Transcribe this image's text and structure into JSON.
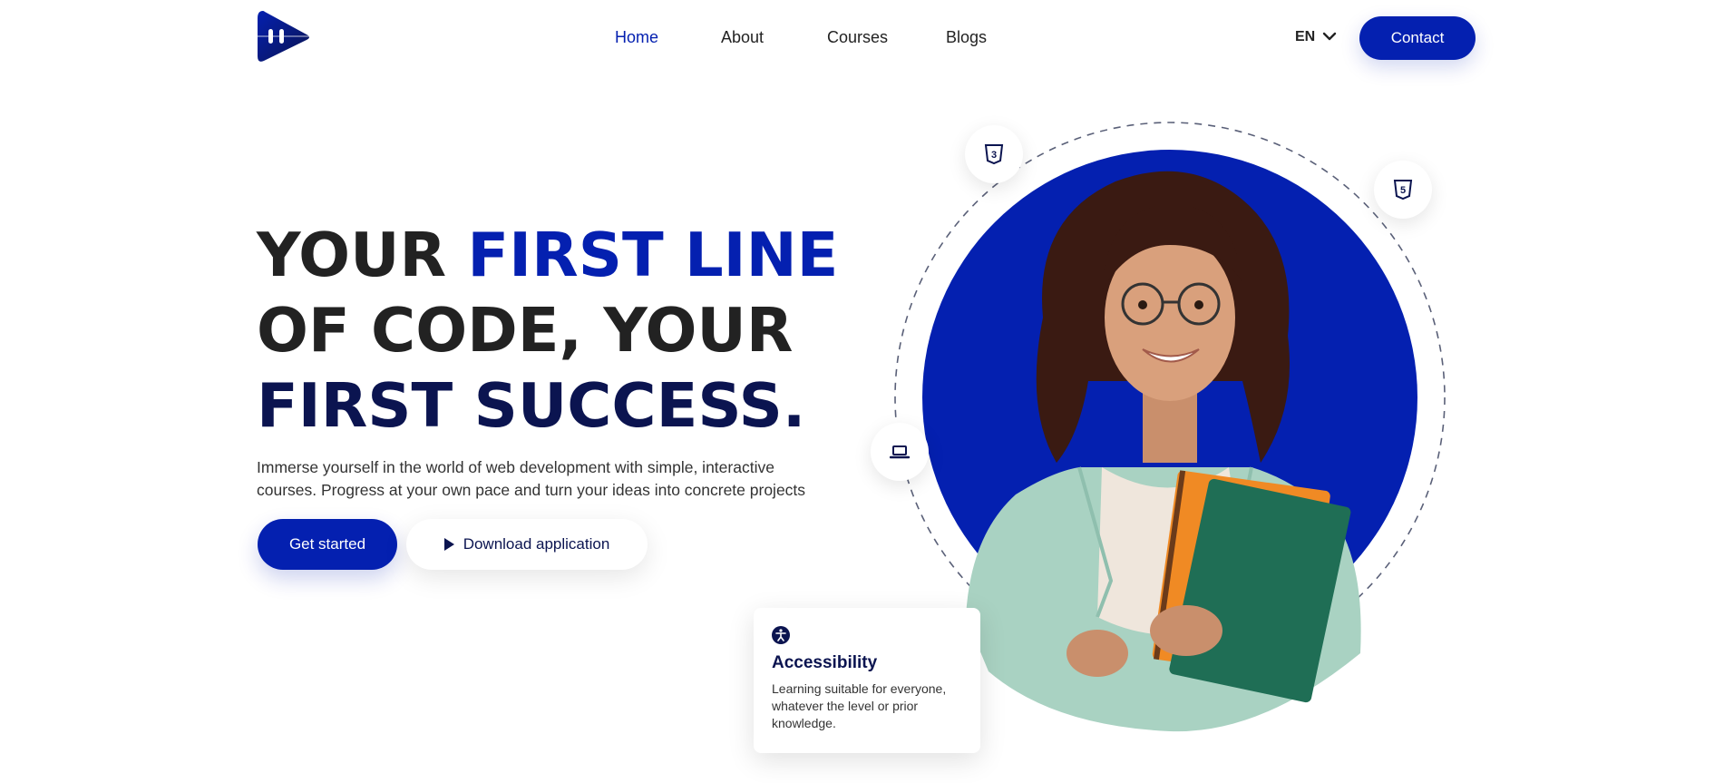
{
  "brand": {
    "logo_icon": "play-brand-logo",
    "accent_color": "#0420b0",
    "navy_color": "#0b1450"
  },
  "nav": {
    "items": [
      {
        "label": "Home",
        "active": true
      },
      {
        "label": "About",
        "active": false
      },
      {
        "label": "Courses",
        "active": false
      },
      {
        "label": "Blogs",
        "active": false
      }
    ],
    "language": "EN",
    "contact_label": "Contact"
  },
  "hero": {
    "headline": {
      "line1_a": "YOUR ",
      "line1_b": "FIRST LINE",
      "line2": "OF CODE, YOUR",
      "line3": "FIRST SUCCESS."
    },
    "description": "Immerse yourself in the world of web development with simple, interactive courses. Progress at your own pace and turn your ideas into concrete projects",
    "primary_button": "Get started",
    "secondary_button": "Download application"
  },
  "illustration": {
    "badges": [
      {
        "icon": "css3-icon",
        "glyph": "3"
      },
      {
        "icon": "html5-icon",
        "glyph": "5"
      },
      {
        "icon": "laptop-icon"
      }
    ],
    "circle_color": "#0420b0"
  },
  "feature_card": {
    "icon": "accessibility-icon",
    "title": "Accessibility",
    "text": "Learning suitable for everyone, whatever the level or prior knowledge."
  }
}
